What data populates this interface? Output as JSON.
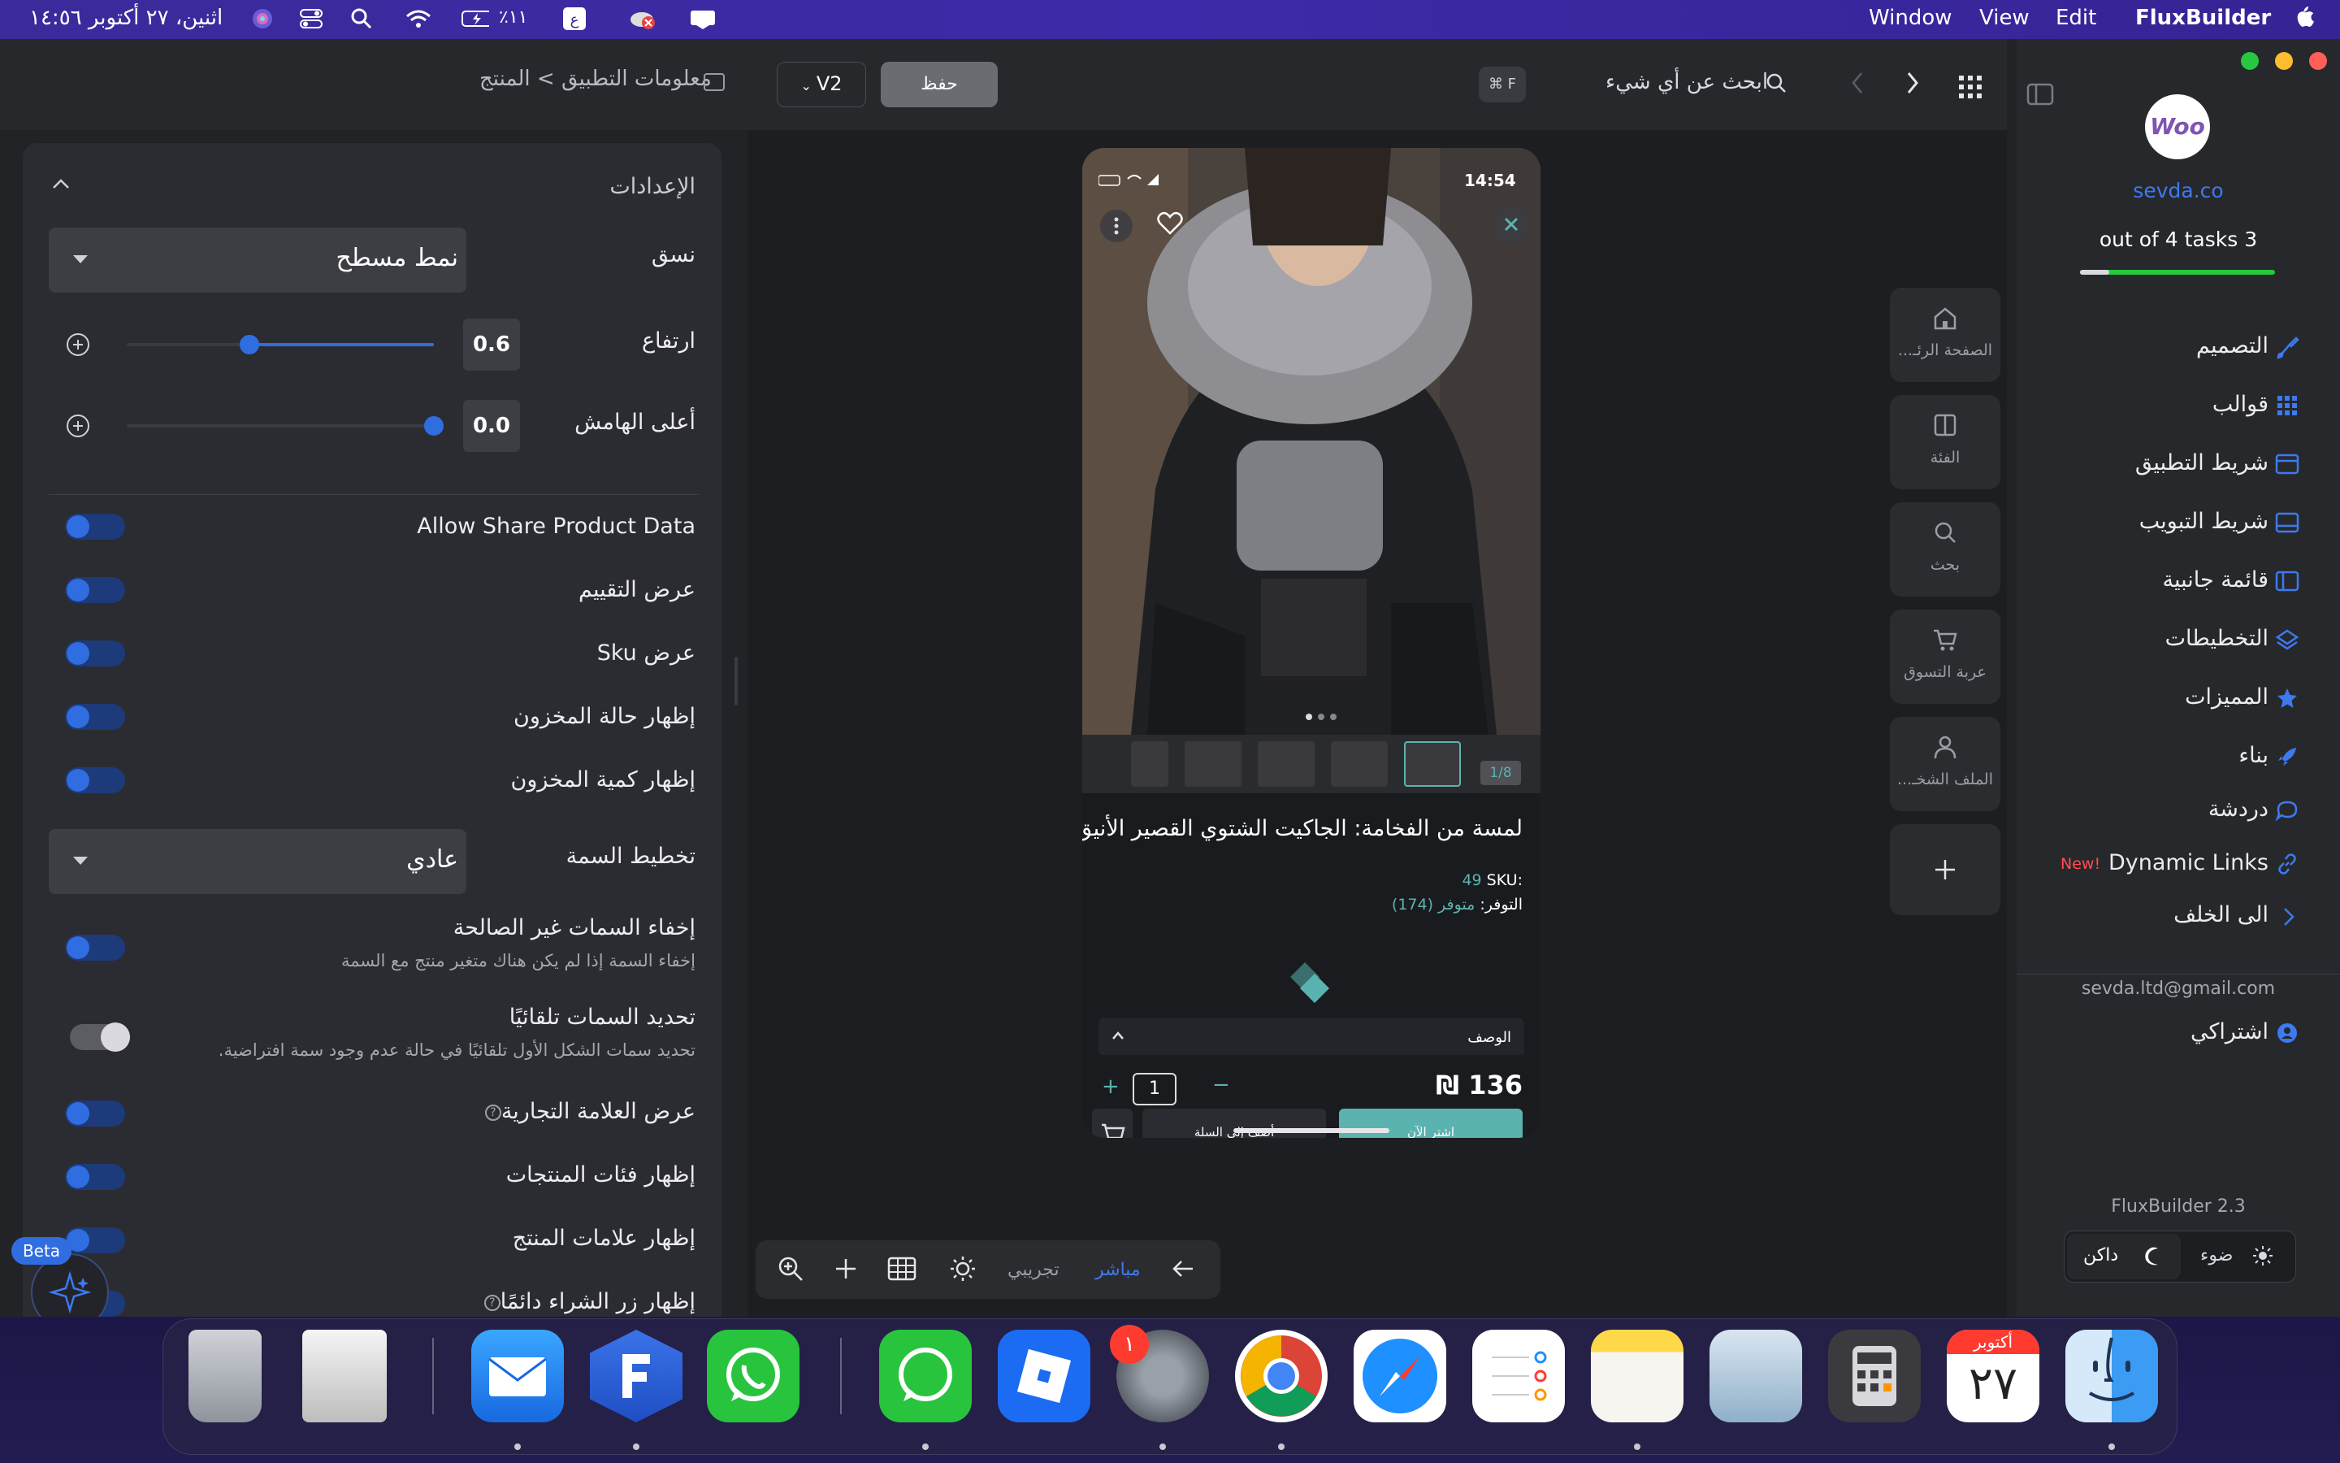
{
  "menubar": {
    "app_name": "FluxBuilder",
    "menus": [
      "Edit",
      "View",
      "Window"
    ],
    "datetime": "اثنين، ٢٧ أكتوبر ١٤:٥٦",
    "battery": "٪١١"
  },
  "header": {
    "breadcrumb": "معلومات التطبيق > المنتج",
    "save_label": "حفظ",
    "version_label": "V2",
    "shortcut_label": "⌘ F",
    "search_placeholder": "ابحث عن أي شيء"
  },
  "settings": {
    "title": "الإعدادات",
    "style_label": "نسق",
    "style_value": "نمط مسطح",
    "height_label": "ارتفاع",
    "height_value": "0.6",
    "height_fraction": 0.4,
    "margin_label": "أعلى الهامش",
    "margin_value": "0.0",
    "margin_fraction": 1.0,
    "toggles": [
      {
        "label": "Allow Share Product Data",
        "on": false
      },
      {
        "label": "عرض التقييم",
        "on": false
      },
      {
        "label": "عرض Sku",
        "on": false
      },
      {
        "label": "إظهار حالة المخزون",
        "on": false
      },
      {
        "label": "إظهار كمية المخزون",
        "on": false
      }
    ],
    "attr_layout_label": "تخطيط السمة",
    "attr_layout_value": "عادي",
    "hide_invalid_label": "إخفاء السمات غير الصالحة",
    "hide_invalid_sub": "إخفاء السمة إذا لم يكن هناك متغير منتج مع السمة",
    "auto_select_label": "تحديد السمات تلقائيًا",
    "auto_select_sub": "تحديد سمات الشكل الأول تلقائيًا في حالة عدم وجود سمة افتراضية.",
    "show_brand_label": "عرض العلامة التجارية",
    "show_categories_label": "إظهار فئات المنتجات",
    "show_tags_label": "إظهار علامات المنتج",
    "always_buy_label": "إظهار زر الشراء دائمًا",
    "beta_label": "Beta"
  },
  "phone": {
    "time": "14:54",
    "image_counter": "1/8",
    "product_title": "لمسة من الفخامة: الجاكيت الشتوي القصير الأنيق",
    "sku_label": "SKU:",
    "sku_value": "49",
    "availability_label": "التوفر:",
    "availability_value": "متوفر (174)",
    "description_label": "الوصف",
    "price": "136",
    "currency": "₪",
    "quantity": "1",
    "buy_now": "اشتر الآن",
    "add_to_cart": "أضف إلى السلة"
  },
  "canvas_nav": [
    {
      "icon": "home-icon",
      "label": "الصفحة الرئـ..."
    },
    {
      "icon": "category-icon",
      "label": "الفئة"
    },
    {
      "icon": "search-icon",
      "label": "بحث"
    },
    {
      "icon": "cart-icon",
      "label": "عربة التسوق"
    },
    {
      "icon": "profile-icon",
      "label": "الملف الشخـ..."
    }
  ],
  "canvas_tools": {
    "live_label": "مباشر",
    "test_label": "تجريبي"
  },
  "sidebar": {
    "logo_text": "Woo",
    "site": "sevda.co",
    "tasks": "out of 4 tasks 3",
    "tasks_progress": 0.15,
    "items": [
      {
        "label": "التصميم",
        "icon": "brush-icon"
      },
      {
        "label": "قوالب",
        "icon": "grid-icon"
      },
      {
        "label": "شريط التطبيق",
        "icon": "appbar-icon"
      },
      {
        "label": "شريط التبويب",
        "icon": "tabbar-icon"
      },
      {
        "label": "قائمة جانبية",
        "icon": "sidemenu-icon"
      },
      {
        "label": "التخطيطات",
        "icon": "layers-icon"
      },
      {
        "label": "المميزات",
        "icon": "star-icon"
      },
      {
        "label": "بناء",
        "icon": "rocket-icon"
      },
      {
        "label": "دردشة",
        "icon": "chat-icon"
      },
      {
        "label": "Dynamic Links",
        "icon": "link-icon",
        "badge": "New!"
      },
      {
        "label": "الى الخلف",
        "icon": "chevron-right-icon"
      }
    ],
    "email": "sevda.ltd@gmail.com",
    "subscription": "اشتراكي",
    "version": "FluxBuilder 2.3",
    "light_label": "ضوء",
    "dark_label": "داكن"
  },
  "dock": {
    "calendar_month": "أكتوبر",
    "calendar_day": "٢٧",
    "settings_badge": "١"
  },
  "colors": {
    "accent": "#2f6de1",
    "teal": "#5bb3b0",
    "menubar": "#3a2a9a"
  }
}
